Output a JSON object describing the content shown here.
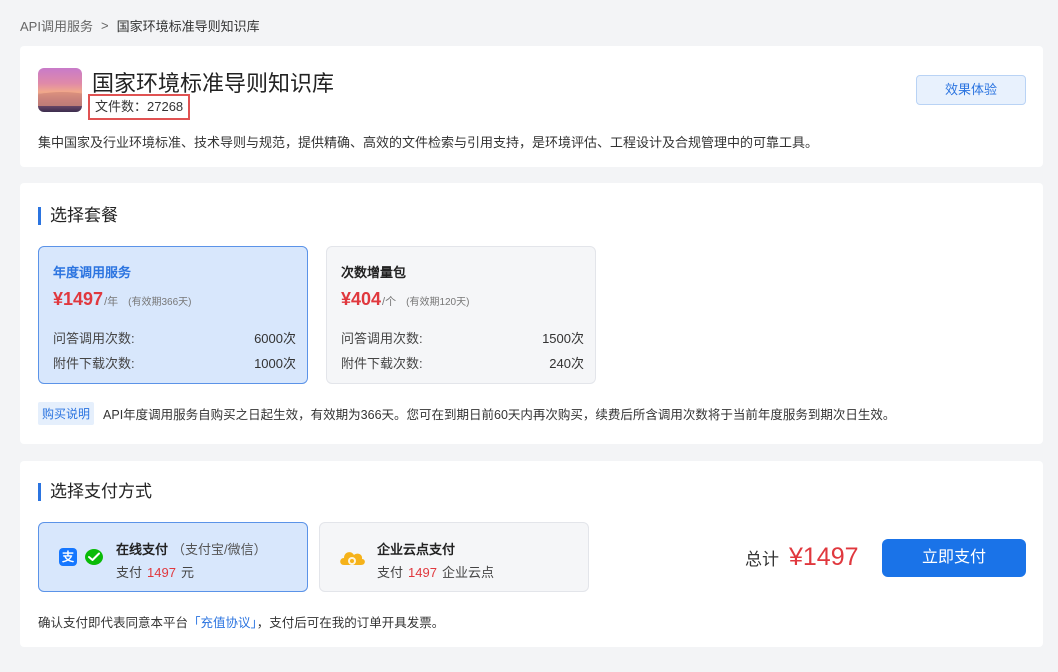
{
  "breadcrumb": {
    "parent": "API调用服务",
    "separator": ">",
    "current": "国家环境标准导则知识库"
  },
  "kb": {
    "title": "国家环境标准导则知识库",
    "file_count_label": "文件数：27268",
    "try_button": "效果体验",
    "description": "集中国家及行业环境标准、技术导则与规范，提供精确、高效的文件检索与引用支持，是环境评估、工程设计及合规管理中的可靠工具。"
  },
  "plan_section": {
    "title": "选择套餐",
    "plans": [
      {
        "name": "年度调用服务",
        "price": "¥1497",
        "unit": "/年",
        "validity": "(有效期366天)",
        "rows": [
          {
            "label": "问答调用次数:",
            "value": "6000次"
          },
          {
            "label": "附件下载次数:",
            "value": "1000次"
          }
        ],
        "selected": true
      },
      {
        "name": "次数增量包",
        "price": "¥404",
        "unit": "/个",
        "validity": "(有效期120天)",
        "rows": [
          {
            "label": "问答调用次数:",
            "value": "1500次"
          },
          {
            "label": "附件下载次数:",
            "value": "240次"
          }
        ],
        "selected": false
      }
    ],
    "note_tag": "购买说明",
    "note_text": "API年度调用服务自购买之日起生效，有效期为366天。您可在到期日前60天内再次购买，续费后所含调用次数将于当前年度服务到期次日生效。"
  },
  "pay_section": {
    "title": "选择支付方式",
    "methods": [
      {
        "name": "在线支付",
        "sub": "（支付宝/微信）",
        "amount_prefix": "支付",
        "amount": "1497",
        "amount_suffix": "元",
        "icons": [
          "alipay-icon",
          "wechat-icon"
        ],
        "selected": true
      },
      {
        "name": "企业云点支付",
        "sub": "",
        "amount_prefix": "支付",
        "amount": "1497",
        "amount_suffix": "企业云点",
        "icons": [
          "cloud-icon"
        ],
        "selected": false
      }
    ],
    "total_label": "总计",
    "total_value": "¥1497",
    "pay_button": "立即支付",
    "agree_prefix": "确认支付即代表同意本平台",
    "agree_link": "「充值协议」",
    "agree_suffix": "，支付后可在我的订单开具发票。"
  },
  "colors": {
    "accent": "#1a73e8",
    "price_red": "#e0383e",
    "selected_bg": "#d8e7fc",
    "highlight_box": "#e05252",
    "alipay": "#1677ff",
    "wechat": "#09bb07",
    "cloud": "#f5b21a"
  }
}
